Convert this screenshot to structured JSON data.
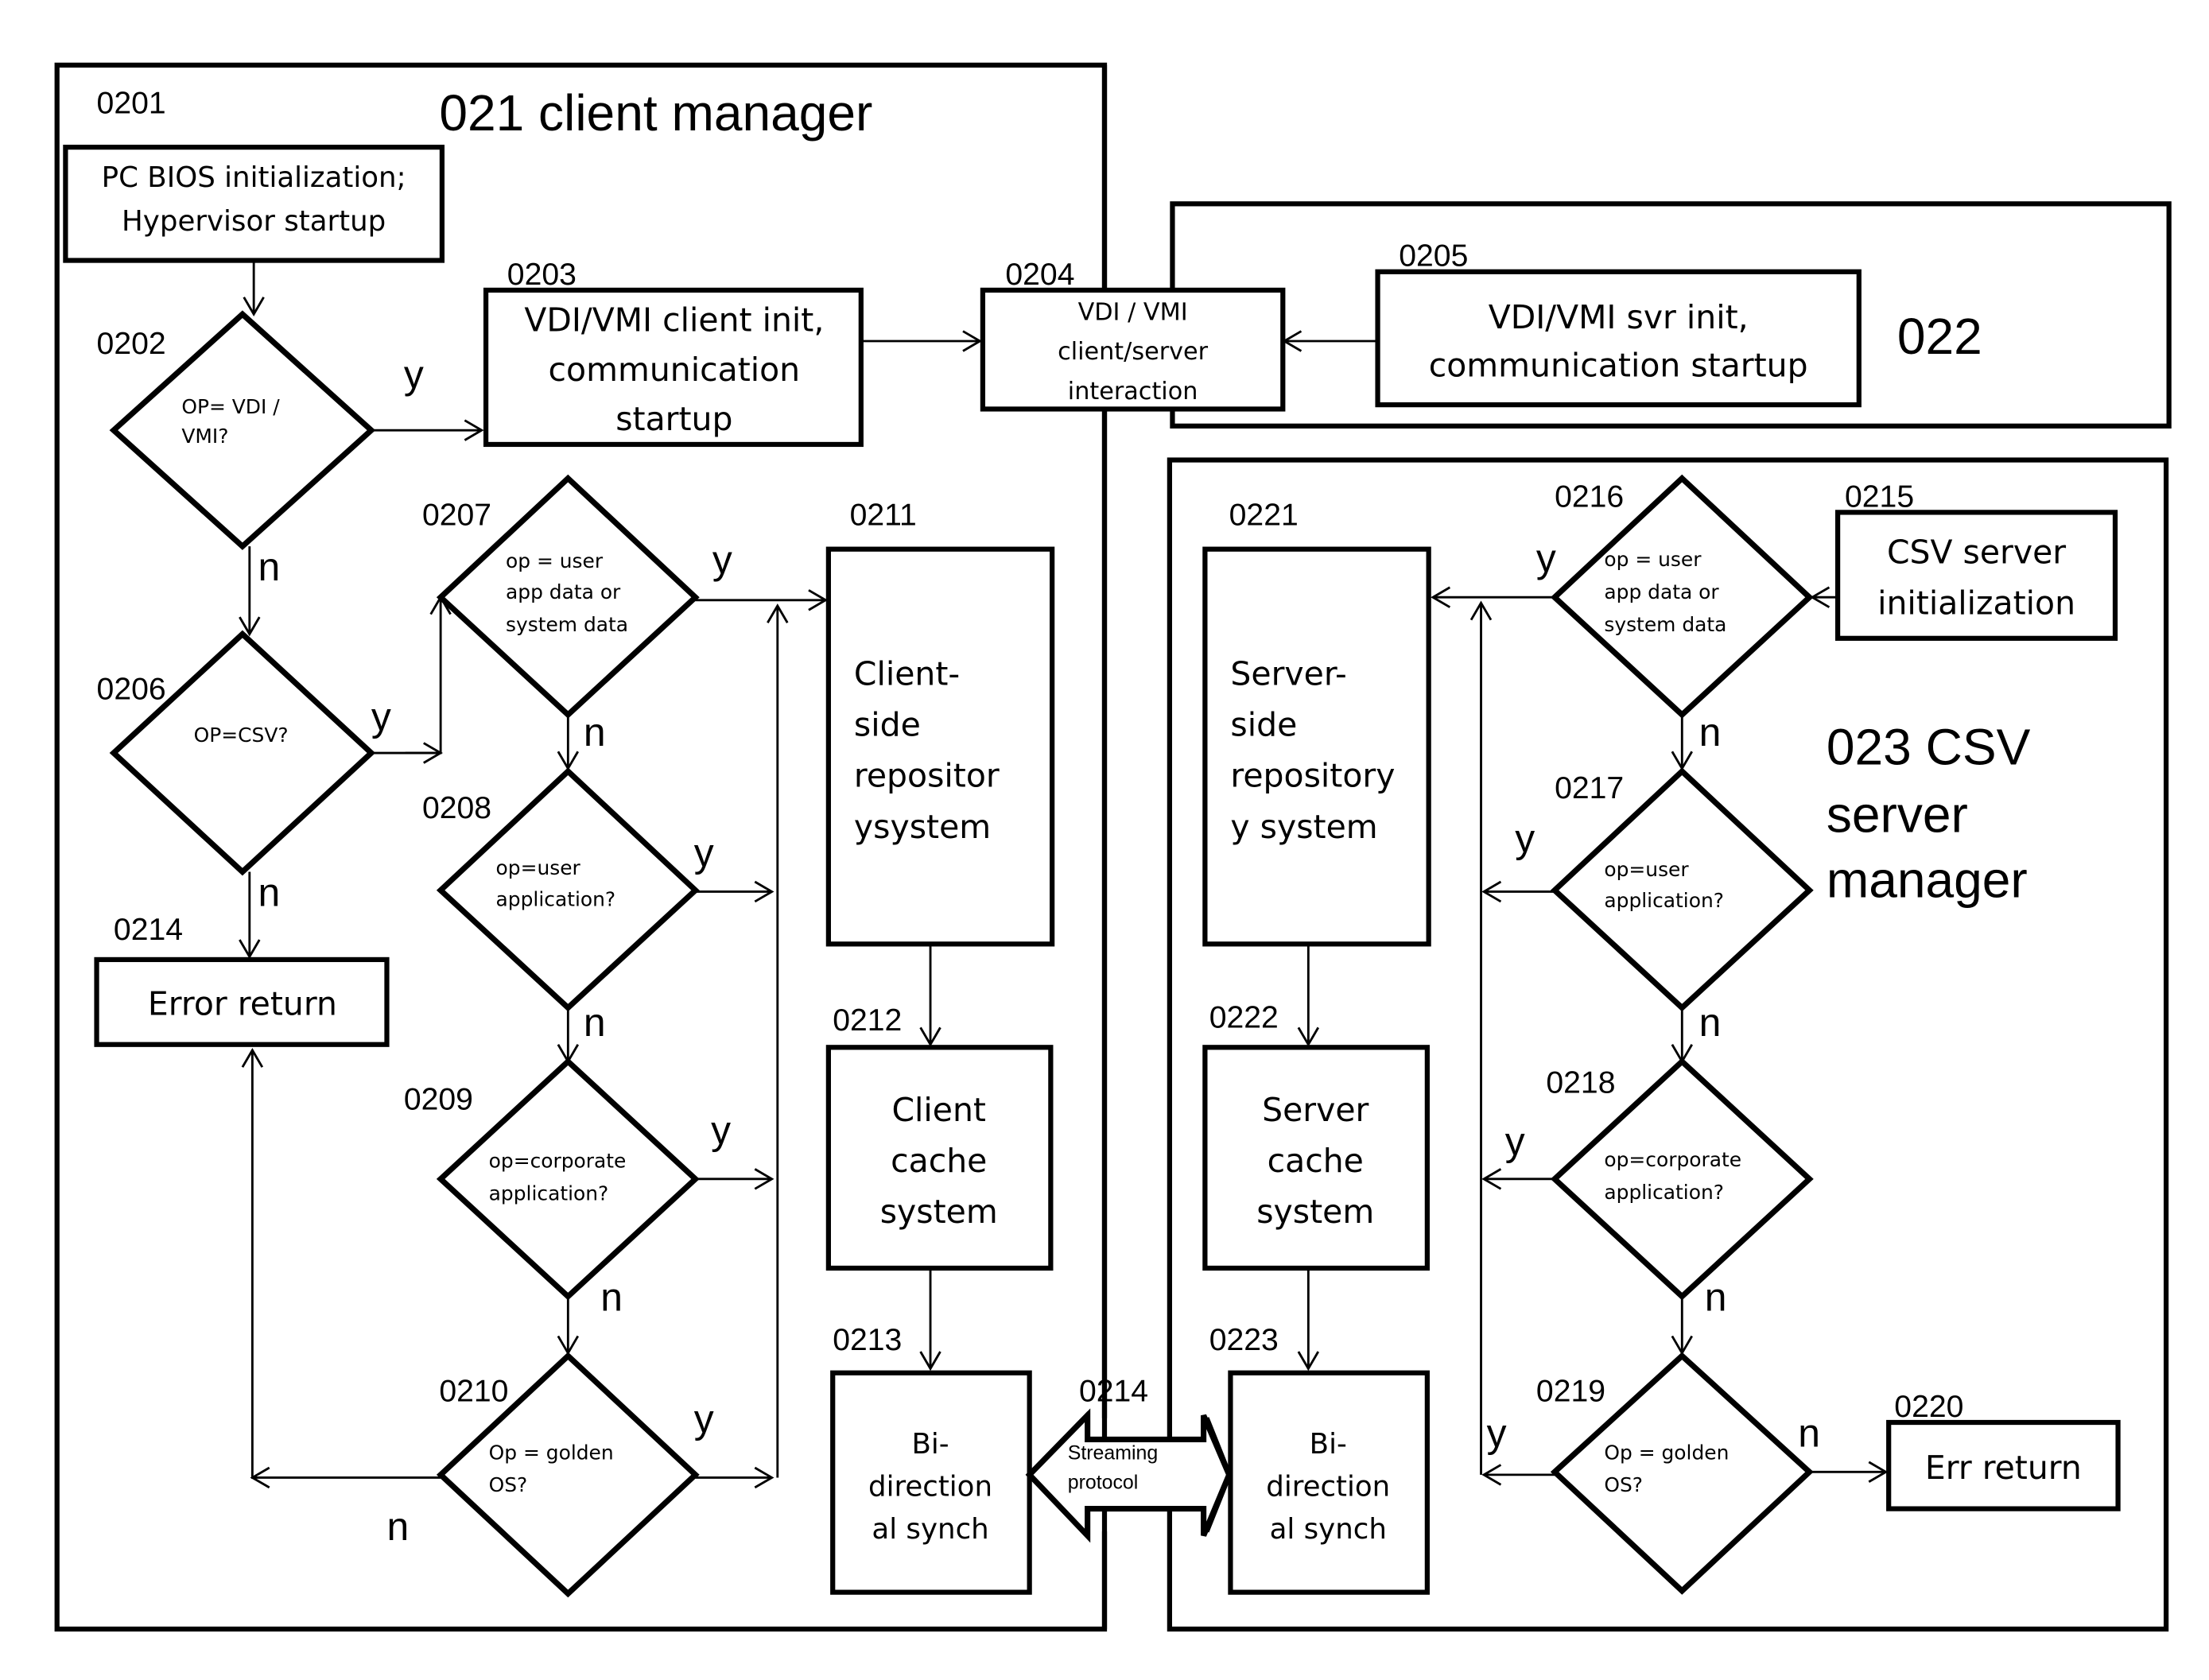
{
  "groups": {
    "client_manager": "021 client manager",
    "vdi_server": "022",
    "csv_server_manager": [
      "023 CSV",
      "server",
      "manager"
    ]
  },
  "nodes": {
    "n0201": {
      "ref": "0201",
      "lines": [
        "PC BIOS initialization;",
        "Hypervisor startup"
      ]
    },
    "n0202": {
      "ref": "0202",
      "lines": [
        "OP= VDI /",
        "VMI?"
      ]
    },
    "n0203": {
      "ref": "0203",
      "lines": [
        "VDI/VMI client init,",
        "communication",
        "startup"
      ]
    },
    "n0204": {
      "ref": "0204",
      "lines": [
        "VDI / VMI",
        "client/server",
        "interaction"
      ]
    },
    "n0205": {
      "ref": "0205",
      "lines": [
        "VDI/VMI svr init,",
        "communication startup"
      ]
    },
    "n0206": {
      "ref": "0206",
      "lines": [
        "OP=CSV?"
      ]
    },
    "n0207": {
      "ref": "0207",
      "lines": [
        "op = user",
        "app data or",
        "system data"
      ]
    },
    "n0208": {
      "ref": "0208",
      "lines": [
        "op=user",
        "application?"
      ]
    },
    "n0209": {
      "ref": "0209",
      "lines": [
        "op=corporate",
        "application?"
      ]
    },
    "n0210": {
      "ref": "0210",
      "lines": [
        "Op = golden",
        "OS?"
      ]
    },
    "n0211": {
      "ref": "0211",
      "lines": [
        "Client-",
        "side",
        "repositor",
        "ysystem"
      ]
    },
    "n0212": {
      "ref": "0212",
      "lines": [
        "Client",
        "cache",
        "system"
      ]
    },
    "n0213": {
      "ref": "0213",
      "lines": [
        "Bi-",
        "direction",
        "al synch"
      ]
    },
    "n0214_err": {
      "ref": "0214",
      "lines": [
        "Error return"
      ]
    },
    "n0214_stream": {
      "ref": "0214",
      "lines": [
        "Streaming",
        "protocol"
      ]
    },
    "n0215": {
      "ref": "0215",
      "lines": [
        "CSV server",
        "initialization"
      ]
    },
    "n0216": {
      "ref": "0216",
      "lines": [
        "op = user",
        "app data or",
        "system data"
      ]
    },
    "n0217": {
      "ref": "0217",
      "lines": [
        "op=user",
        "application?"
      ]
    },
    "n0218": {
      "ref": "0218",
      "lines": [
        "op=corporate",
        "application?"
      ]
    },
    "n0219": {
      "ref": "0219",
      "lines": [
        "Op = golden",
        "OS?"
      ]
    },
    "n0220": {
      "ref": "0220",
      "lines": [
        "Err return"
      ]
    },
    "n0221": {
      "ref": "0221",
      "lines": [
        "Server-",
        "side",
        "repository",
        "y system"
      ]
    },
    "n0222": {
      "ref": "0222",
      "lines": [
        "Server",
        "cache",
        "system"
      ]
    },
    "n0223": {
      "ref": "0223",
      "lines": [
        "Bi-",
        "direction",
        "al synch"
      ]
    }
  },
  "edge_labels": {
    "yes": "y",
    "no": "n"
  }
}
